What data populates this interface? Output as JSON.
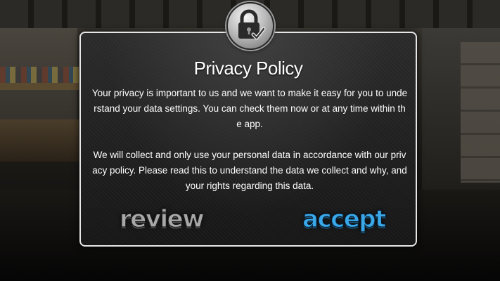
{
  "dialog": {
    "title": "Privacy Policy",
    "icon": "lock-check-icon",
    "paragraphs": [
      "Your privacy is important to us and we want to make it easy for you to understand your data settings. You can check them now or at any time within the app.",
      "We will collect and only use your personal data in accordance with our privacy policy. Please read this to understand the data we collect and why, and your rights regarding this data."
    ],
    "buttons": {
      "review": "review",
      "accept": "accept"
    }
  },
  "colors": {
    "accept": "#3aa8e8",
    "review": "#a8a8a8",
    "border": "#e6e6e6"
  }
}
